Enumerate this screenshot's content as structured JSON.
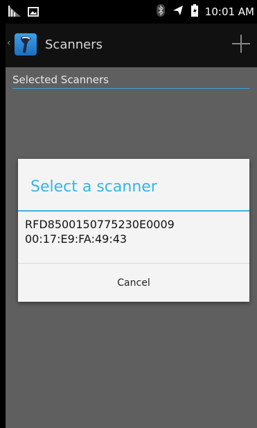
{
  "status_bar": {
    "time": "10:01 AM"
  },
  "action_bar": {
    "title": "Scanners"
  },
  "section": {
    "title": "Selected Scanners"
  },
  "dialog": {
    "title": "Select a scanner",
    "items": [
      {
        "name": "RFD8500150775230E0009",
        "address": "00:17:E9:FA:49:43"
      }
    ],
    "cancel_label": "Cancel"
  },
  "colors": {
    "accent": "#33b5e5",
    "background": "#5f5f5f"
  }
}
